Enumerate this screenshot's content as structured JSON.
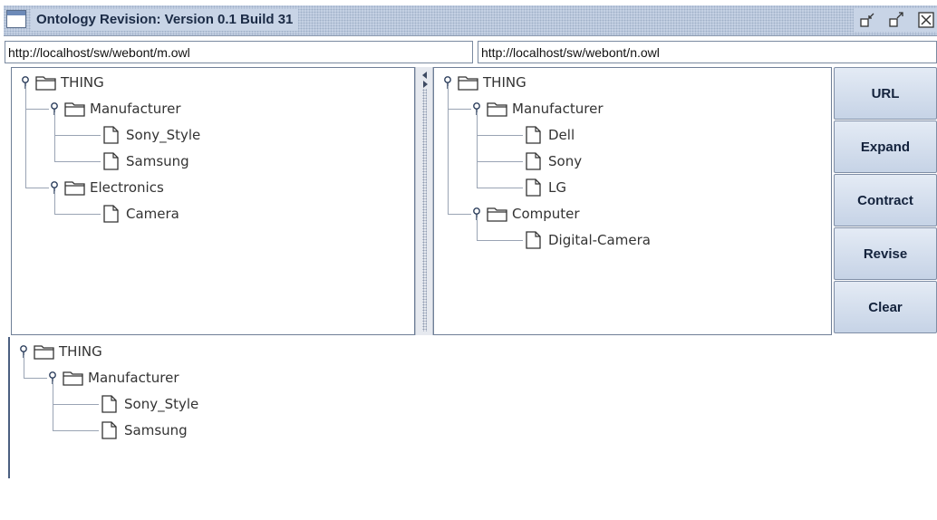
{
  "window": {
    "title": "Ontology Revision: Version 0.1 Build 31",
    "controls": [
      "minimize-icon",
      "maximize-icon",
      "close-icon"
    ]
  },
  "urls": {
    "left": "http://localhost/sw/webont/m.owl",
    "right": "http://localhost/sw/webont/n.owl"
  },
  "trees": {
    "left": {
      "root": "THING",
      "folders": [
        {
          "label": "Manufacturer",
          "children": [
            "Sony_Style",
            "Samsung"
          ]
        },
        {
          "label": "Electronics",
          "children": [
            "Camera"
          ]
        }
      ]
    },
    "right": {
      "root": "THING",
      "folders": [
        {
          "label": "Manufacturer",
          "children": [
            "Dell",
            "Sony",
            "LG"
          ]
        },
        {
          "label": "Computer",
          "children": [
            "Digital-Camera"
          ]
        }
      ]
    },
    "result": {
      "root": "THING",
      "folders": [
        {
          "label": "Manufacturer",
          "children": [
            "Sony_Style",
            "Samsung"
          ]
        }
      ]
    }
  },
  "buttons": {
    "url": "URL",
    "expand": "Expand",
    "contract": "Contract",
    "revise": "Revise",
    "clear": "Clear"
  },
  "icons": {
    "root": "folder-icon",
    "folder": "folder-icon",
    "leaf": "document-icon",
    "handle": "tree-expand-handle-icon"
  },
  "colors": {
    "titlebar": "#c8d4e6",
    "button": "#d5dfee",
    "tree_line": "#9aa4b4"
  }
}
